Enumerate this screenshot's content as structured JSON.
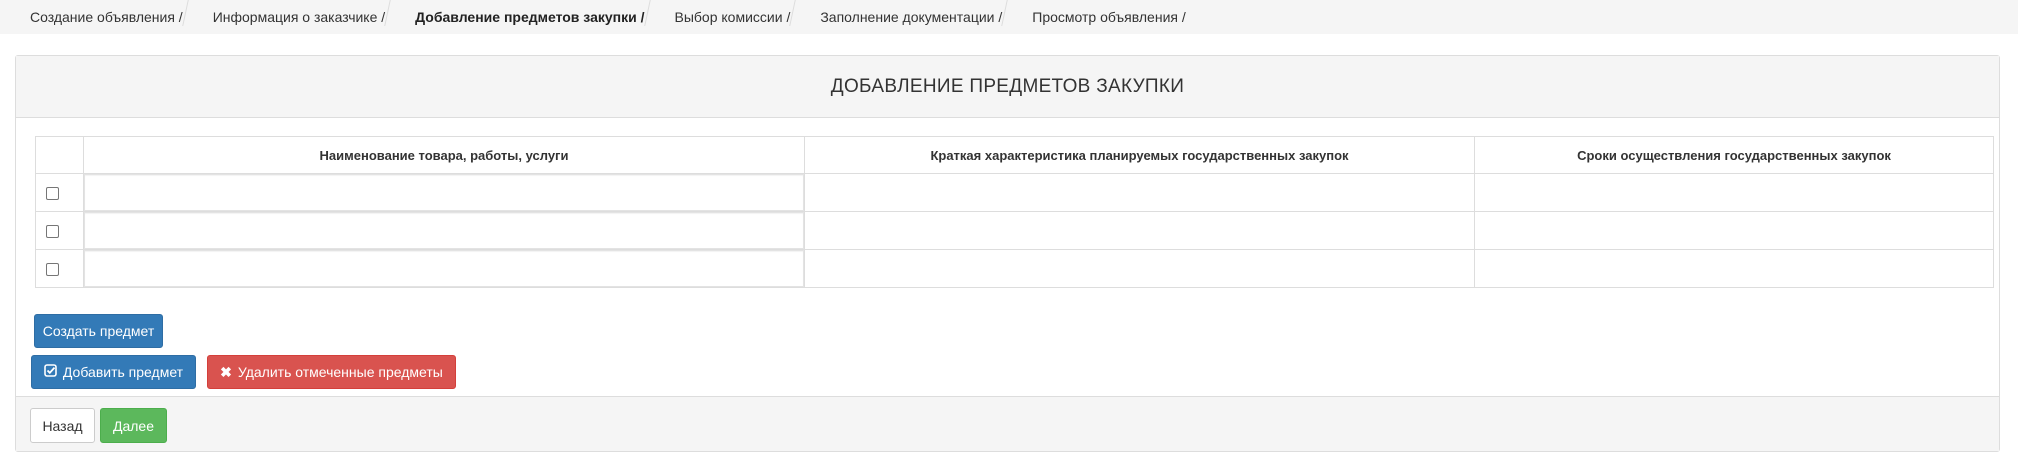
{
  "breadcrumb": {
    "items": [
      {
        "label": "Создание объявления /",
        "active": false
      },
      {
        "label": "Информация о заказчике /",
        "active": false
      },
      {
        "label": "Добавление предметов закупки /",
        "active": true
      },
      {
        "label": "Выбор комиссии /",
        "active": false
      },
      {
        "label": "Заполнение документации /",
        "active": false
      },
      {
        "label": "Просмотр объявления /",
        "active": false
      }
    ]
  },
  "panel": {
    "title": "ДОБАВЛЕНИЕ ПРЕДМЕТОВ ЗАКУПКИ"
  },
  "table": {
    "columns": [
      "Наименование товара, работы, услуги",
      "Краткая характеристика планируемых государственных закупок",
      "Сроки осуществления государственных закупок"
    ],
    "rows": [
      {
        "checked": false,
        "name": "",
        "description": "",
        "period": ""
      },
      {
        "checked": false,
        "name": "",
        "description": "",
        "period": ""
      },
      {
        "checked": false,
        "name": "",
        "description": "",
        "period": ""
      }
    ]
  },
  "actions": {
    "create_label": "Создать предмет",
    "add_label": "Добавить предмет",
    "add_icon": "check-square-icon",
    "delete_label": "Удалить отмеченные предметы",
    "delete_icon": "close-icon"
  },
  "footer": {
    "back_label": "Назад",
    "next_label": "Далее"
  },
  "colors": {
    "primary": "#337ab7",
    "danger": "#d9534f",
    "success": "#5cb85c"
  }
}
